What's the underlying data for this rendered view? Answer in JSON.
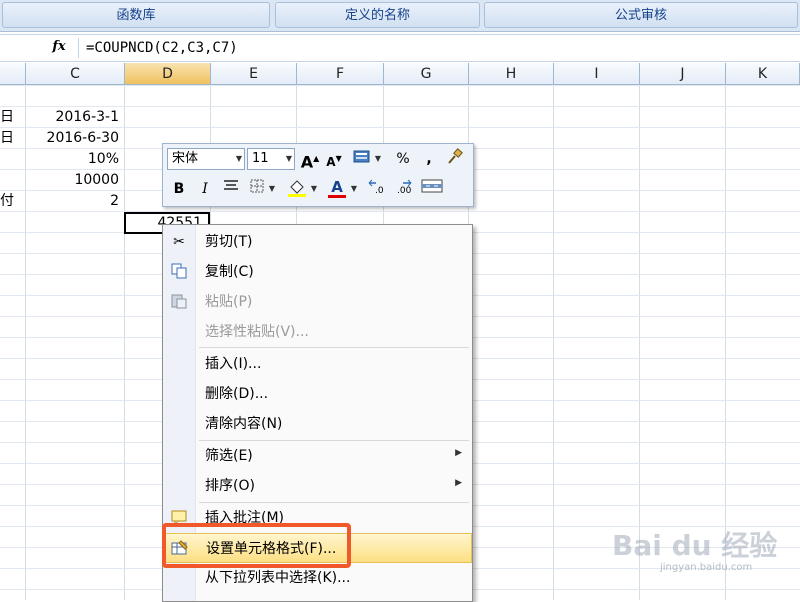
{
  "ribbon": {
    "groups": [
      "函数库",
      "定义的名称",
      "公式审核"
    ]
  },
  "formula_bar": {
    "fx_label": "fx",
    "formula": "=COUPNCD(C2,C3,C7)"
  },
  "grid": {
    "columns": [
      "C",
      "D",
      "E",
      "F",
      "G",
      "H",
      "I",
      "J",
      "K"
    ],
    "selected_column": "D",
    "row_labels": [
      "日",
      "日",
      "",
      "",
      "付"
    ],
    "c_values": [
      "2016-3-1",
      "2016-6-30",
      "10%",
      "10000",
      "2"
    ],
    "active_cell_value": "42551"
  },
  "mini_toolbar": {
    "font_name": "宋体",
    "font_size": "11",
    "grow_font": "A",
    "shrink_font": "A",
    "percent": "%",
    "comma": ",",
    "bold": "B",
    "italic": "I",
    "font_color": "A",
    "highlight_color": "#ffff00",
    "text_color": "#e00000"
  },
  "context_menu": {
    "items": [
      {
        "label": "剪切(T)",
        "icon": "scissors-icon",
        "enabled": true
      },
      {
        "label": "复制(C)",
        "icon": "copy-icon",
        "enabled": true
      },
      {
        "label": "粘贴(P)",
        "icon": "paste-icon",
        "enabled": false
      },
      {
        "label": "选择性粘贴(V)...",
        "icon": "",
        "enabled": false
      },
      {
        "label": "插入(I)...",
        "icon": "",
        "enabled": true
      },
      {
        "label": "删除(D)...",
        "icon": "",
        "enabled": true
      },
      {
        "label": "清除内容(N)",
        "icon": "",
        "enabled": true
      },
      {
        "label": "筛选(E)",
        "icon": "",
        "enabled": true,
        "submenu": true
      },
      {
        "label": "排序(O)",
        "icon": "",
        "enabled": true,
        "submenu": true
      },
      {
        "label": "插入批注(M)",
        "icon": "comment-icon",
        "enabled": true
      },
      {
        "label": "设置单元格格式(F)...",
        "icon": "format-cells-icon",
        "enabled": true,
        "highlighted": true
      },
      {
        "label": "从下拉列表中选择(K)...",
        "icon": "",
        "enabled": true
      }
    ]
  },
  "watermark": {
    "line1": "Bai du 经验",
    "line2": "jingyan.baidu.com"
  },
  "colors": {
    "highlight_border": "#f2592a",
    "selected_header": "#f1c15e"
  }
}
